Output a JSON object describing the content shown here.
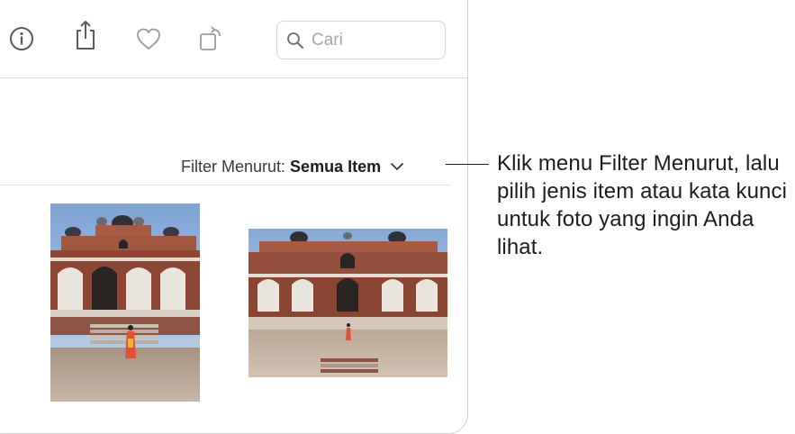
{
  "toolbar": {
    "icons": [
      "info-icon",
      "share-icon",
      "heart-icon",
      "rotate-icon",
      "search-icon"
    ],
    "search_placeholder": "Cari"
  },
  "filter": {
    "label": "Filter Menurut:",
    "value": "Semua Item"
  },
  "photos": [
    {
      "subject": "photo of Humayun's Tomb, portrait"
    },
    {
      "subject": "photo of Humayun's Tomb, landscape"
    }
  ],
  "callout": {
    "text": "Klik menu Filter Menurut, lalu pilih jenis item atau kata kunci untuk foto yang ingin Anda lihat."
  },
  "colors": {
    "sky": "#8fb0d8",
    "sandstone": "#9a4f3c",
    "marble": "#e9e4dc",
    "ground": "#b9a494",
    "figure": "#e0533a"
  }
}
